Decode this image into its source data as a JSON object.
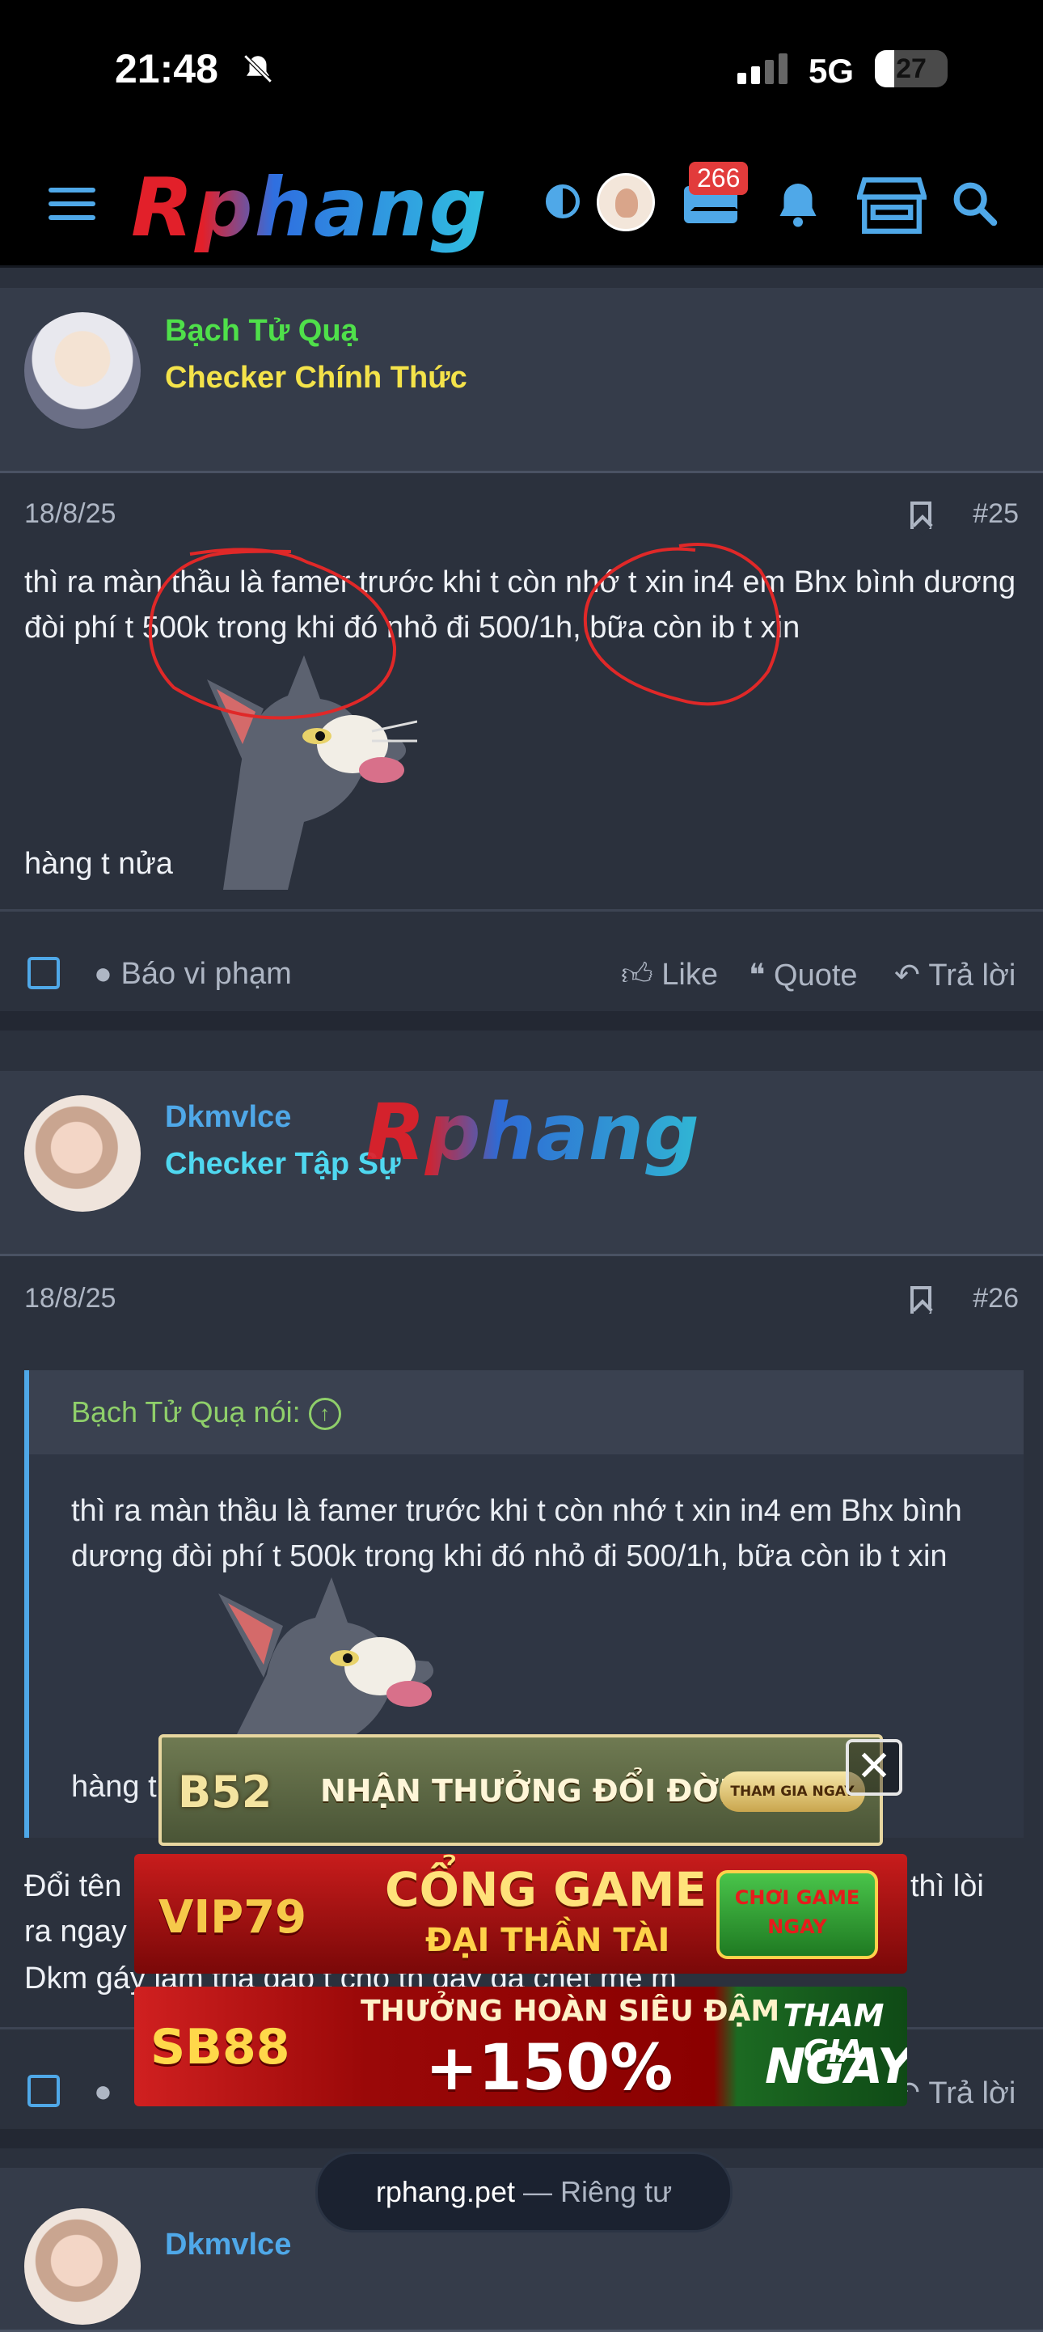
{
  "status": {
    "time": "21:48",
    "network": "5G",
    "battery": "27"
  },
  "nav": {
    "logo": "Rphang",
    "mail_badge": "266"
  },
  "posts": [
    {
      "username": "Bạch Tử Quạ",
      "user_title": "Checker Chính Thức",
      "date": "18/8/25",
      "number": "#25",
      "text_top": "thì ra màn thầu là famer trước khi t còn nhớ t xin in4 em Bhx bình dương đòi phí t 500k trong khi đó nhỏ đi 500/1h, bữa còn ib t xin",
      "text_bottom": "hàng t nửa"
    },
    {
      "username": "Dkmvlce",
      "user_title": "Checker Tập Sự",
      "date": "18/8/25",
      "number": "#26",
      "quote_author": "Bạch Tử Quạ nói:",
      "quote_text": "thì ra màn thầu là famer trước khi t còn nhớ t xin in4 em Bhx bình dương đòi phí t 500k trong khi đó nhỏ đi 500/1h, bữa còn ib t xin",
      "quote_bottom": "hàng t",
      "reply_line1": "Đổi tên",
      "reply_line1_end": "thì lòi",
      "reply_line2": "ra ngay",
      "reply_line3": "Dkm gáy làm thả gáp t cho th gáy gà chết mẹ m"
    },
    {
      "username": "Dkmvlce"
    }
  ],
  "actions": {
    "report": "Báo vi phạm",
    "like": "Like",
    "quote": "Quote",
    "reply": "Trả lời"
  },
  "watermark": "Rphang",
  "ads": {
    "b52_brand": "B52",
    "b52_text": "NHẬN THƯỞNG ĐỔI ĐỜI",
    "b52_btn": "THAM GIA NGAY",
    "vip_brand": "VIP79",
    "vip_text1": "CỔNG GAME",
    "vip_text2": "ĐẠI THẦN TÀI",
    "vip_btn1": "CHƠI GAME",
    "vip_btn2": "NGAY",
    "sb_brand": "SB88",
    "sb_text1": "THƯỞNG HOÀN SIÊU ĐẬM",
    "sb_text2": "+150%",
    "sb_btn1": "THAM GIA",
    "sb_btn2": "NGAY"
  },
  "toast": {
    "domain": "rphang.pet",
    "label": "— Riêng tư"
  }
}
